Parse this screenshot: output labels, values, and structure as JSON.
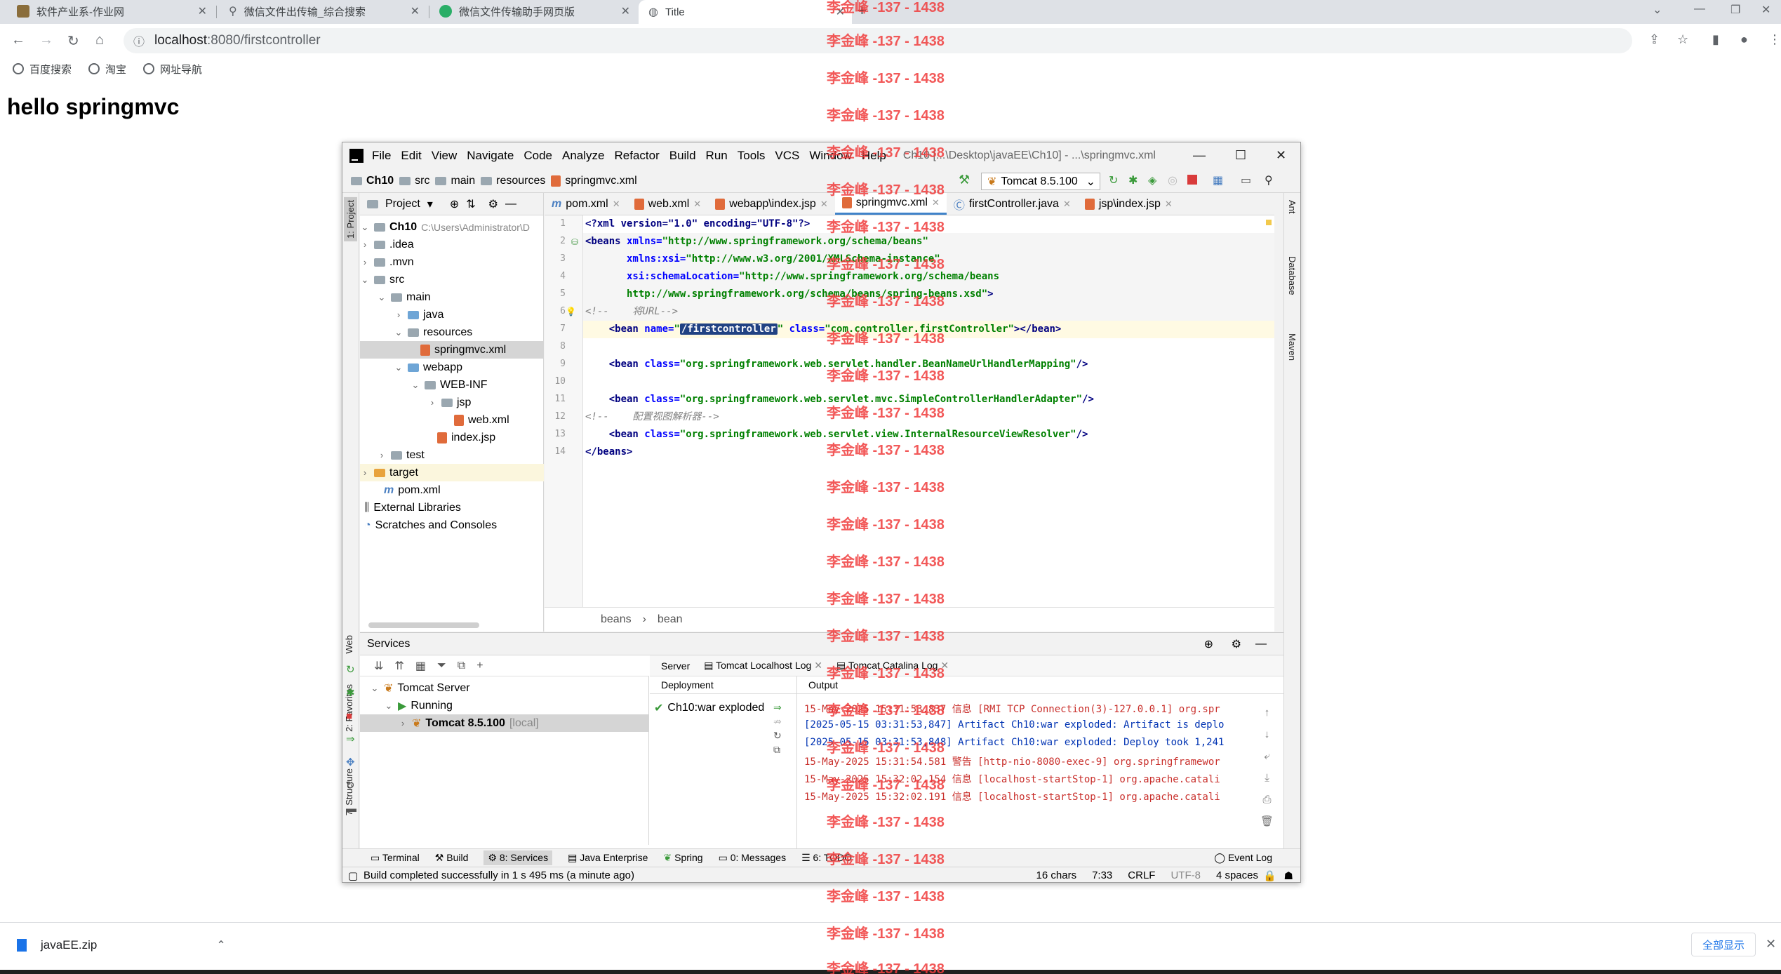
{
  "browser": {
    "tabs": [
      {
        "label": "软件产业系-作业网"
      },
      {
        "label": "微信文件出传输_综合搜索"
      },
      {
        "label": "微信文件传输助手网页版"
      },
      {
        "label": "Title"
      }
    ],
    "url_host": "localhost",
    "url_rest": ":8080/firstcontroller",
    "bookmarks": [
      "百度搜索",
      "淘宝",
      "网址导航"
    ]
  },
  "page": {
    "heading": "hello springmvc"
  },
  "ide": {
    "menus": [
      "File",
      "Edit",
      "View",
      "Navigate",
      "Code",
      "Analyze",
      "Refactor",
      "Build",
      "Run",
      "Tools",
      "VCS",
      "Window",
      "Help"
    ],
    "title": "Ch10 [...\\Desktop\\javaEE\\Ch10] - ...\\springmvc.xml",
    "breadcrumb": [
      "Ch10",
      "src",
      "main",
      "resources",
      "springmvc.xml"
    ],
    "run_config": "Tomcat 8.5.100",
    "project_label": "Project",
    "tree": {
      "root": "Ch10",
      "root_path": "C:\\Users\\Administrator\\D",
      "idea": ".idea",
      "mvn": ".mvn",
      "src": "src",
      "main": "main",
      "java": "java",
      "resources": "resources",
      "springmvc": "springmvc.xml",
      "webapp": "webapp",
      "webinf": "WEB-INF",
      "jsp": "jsp",
      "webxml": "web.xml",
      "indexjsp": "index.jsp",
      "test": "test",
      "target": "target",
      "pom": "pom.xml",
      "ext": "External Libraries",
      "scratch": "Scratches and Consoles"
    },
    "editor_tabs": [
      "pom.xml",
      "web.xml",
      "webapp\\index.jsp",
      "springmvc.xml",
      "firstController.java",
      "jsp\\index.jsp"
    ],
    "line_numbers": [
      "1",
      "2",
      "3",
      "4",
      "5",
      "6",
      "7",
      "8",
      "9",
      "10",
      "11",
      "12",
      "13",
      "14"
    ],
    "code": {
      "l1": "<?xml version=\"1.0\" encoding=\"UTF-8\"?>",
      "l2_tag": "<beans ",
      "l2_attr": "xmlns=",
      "l2_val": "\"http://www.springframework.org/schema/beans\"",
      "l3_attr": "       xmlns:xsi=",
      "l3_val": "\"http://www.w3.org/2001/XMLSchema-instance\"",
      "l4_attr": "       xsi:schemaLocation=",
      "l4_val": "\"http://www.springframework.org/schema/beans",
      "l5_val": "       http://www.springframework.org/schema/beans/spring-beans.xsd\"",
      "l5_end": ">",
      "l6": "<!--    将URL-->",
      "l7_tag": "    <bean ",
      "l7_attr": "name=",
      "l7_q": "\"",
      "l7_sel": "/firstcontroller",
      "l7_q2": "\"",
      "l7_attr2": " class=",
      "l7_val2": "\"com.controller.firstController\"",
      "l7_end": "></bean>",
      "l9_tag": "    <bean ",
      "l9_attr": "class=",
      "l9_val": "\"org.springframework.web.servlet.handler.BeanNameUrlHandlerMapping\"",
      "l9_end": "/>",
      "l11_tag": "    <bean ",
      "l11_attr": "class=",
      "l11_val": "\"org.springframework.web.servlet.mvc.SimpleControllerHandlerAdapter\"",
      "l11_end": "/>",
      "l12": "<!--    配置视图解析器-->",
      "l13_tag": "    <bean ",
      "l13_attr": "class=",
      "l13_val": "\"org.springframework.web.servlet.view.InternalResourceViewResolver\"",
      "l13_end": "/>",
      "l14": "</beans>"
    },
    "editor_crumbs": [
      "beans",
      "bean"
    ],
    "services": {
      "title": "Services",
      "tomcat_server": "Tomcat Server",
      "running": "Running",
      "instance": "Tomcat 8.5.100",
      "instance_suffix": "[local]",
      "tabs": [
        "Server",
        "Tomcat Localhost Log",
        "Tomcat Catalina Log"
      ],
      "deployment_label": "Deployment",
      "output_label": "Output",
      "artifact": "Ch10:war exploded",
      "log": [
        "15-May-2025 15:31:53.837 信息 [RMI TCP Connection(3)-127.0.0.1] org.spr",
        "[2025-05-15 03:31:53,847] Artifact Ch10:war exploded: Artifact is deplo",
        "[2025-05-15 03:31:53,848] Artifact Ch10:war exploded: Deploy took 1,241",
        "15-May-2025 15:31:54.581 警告 [http-nio-8080-exec-9] org.springframewor",
        "15-May-2025 15:32:02.154 信息 [localhost-startStop-1] org.apache.catali",
        "15-May-2025 15:32:02.191 信息 [localhost-startStop-1] org.apache.catali"
      ]
    },
    "bottom_tabs": [
      "Terminal",
      "Build",
      "8: Services",
      "Java Enterprise",
      "Spring",
      "0: Messages",
      "6: TODO",
      "Event Log"
    ],
    "left_stripe": [
      "1: Project",
      "Web",
      "2: Favorites",
      "7: Structure"
    ],
    "right_stripe": [
      "Ant",
      "Database",
      "Maven"
    ],
    "status": {
      "message": "Build completed successfully in 1 s 495 ms (a minute ago)",
      "chars": "16 chars",
      "pos": "7:33",
      "eol": "CRLF",
      "enc": "UTF-8",
      "indent": "4 spaces"
    }
  },
  "downloads": {
    "file": "javaEE.zip",
    "show_all": "全部显示"
  },
  "watermark": "李金峰 -137 - 1438"
}
